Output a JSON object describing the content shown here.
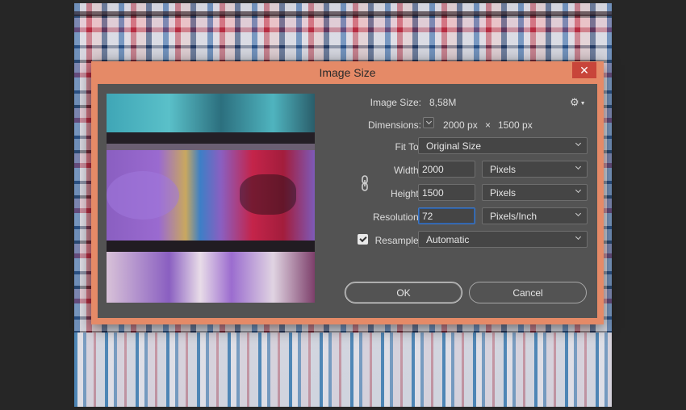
{
  "dialog": {
    "title": "Image Size",
    "close_glyph": "✕"
  },
  "info": {
    "image_size_label": "Image Size:",
    "image_size_value": "8,58M",
    "dimensions_label": "Dimensions:",
    "dimensions_width": "2000 px",
    "dimensions_times": "×",
    "dimensions_height": "1500 px"
  },
  "fit_to": {
    "label": "Fit To:",
    "value": "Original Size"
  },
  "width": {
    "label": "Width:",
    "value": "2000",
    "unit": "Pixels"
  },
  "height": {
    "label": "Height:",
    "value": "1500",
    "unit": "Pixels"
  },
  "resolution": {
    "label": "Resolution:",
    "value": "72",
    "unit": "Pixels/Inch"
  },
  "resample": {
    "label": "Resample:",
    "checked": true,
    "value": "Automatic"
  },
  "buttons": {
    "ok": "OK",
    "cancel": "Cancel"
  },
  "icons": {
    "settings": "gear-icon",
    "constrain": "link-icon",
    "close": "close-icon"
  },
  "colors": {
    "dialog_frame": "#e58a67",
    "dialog_body": "#535353",
    "close_button": "#c8453a",
    "focus": "#3c78c8"
  }
}
